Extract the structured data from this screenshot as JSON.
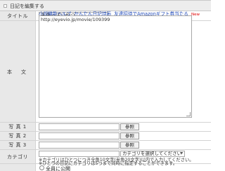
{
  "header": {
    "title": "日記を編集する"
  },
  "title_row": {
    "label": "タイトル",
    "value": "未来っぽいやつ"
  },
  "body_row": {
    "label": "本　文",
    "links": [
      "小説機能ヘルプ",
      "かんたん日記詩画",
      "友達招待でAmazonギフト券当たる"
    ],
    "new_badge": "New",
    "content": "http://eyevio.jp/movie/109399"
  },
  "photos": [
    {
      "label": "写 真 1",
      "button": "参照"
    },
    {
      "label": "写 真 2",
      "button": "参照"
    },
    {
      "label": "写 真 3",
      "button": "参照"
    }
  ],
  "category": {
    "label": "カテゴリ",
    "select_value": "カテゴリを選択してください",
    "note1": "※カテゴリはひとつにつき全角10文字(半角20文字)以内で入力してください。",
    "note2": "※ひとつの日記にカテゴリは5つまで同時に指定することができます。"
  },
  "visibility": {
    "option_label": "全員に公開"
  }
}
